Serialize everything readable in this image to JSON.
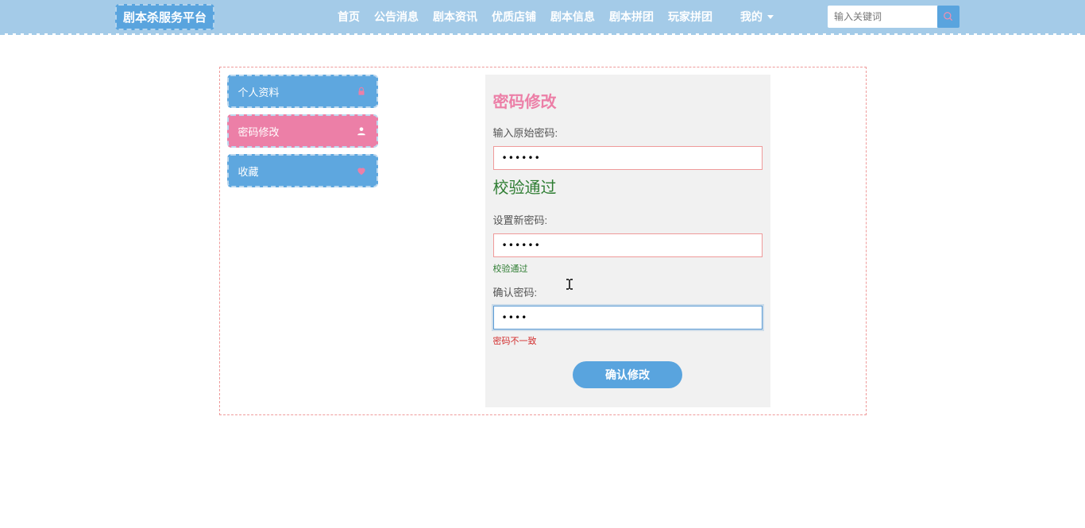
{
  "header": {
    "brand": "剧本杀服务平台",
    "nav": [
      "首页",
      "公告消息",
      "剧本资讯",
      "优质店铺",
      "剧本信息",
      "剧本拼团",
      "玩家拼团"
    ],
    "mine": "我的",
    "search_placeholder": "输入关键词"
  },
  "sidebar": {
    "items": [
      {
        "label": "个人资料",
        "active": false,
        "icon": "lock-icon"
      },
      {
        "label": "密码修改",
        "active": true,
        "icon": "user-icon"
      },
      {
        "label": "收藏",
        "active": false,
        "icon": "heart-icon"
      }
    ]
  },
  "form": {
    "title": "密码修改",
    "original": {
      "label": "输入原始密码:",
      "value": "••••••",
      "status": "校验通过"
    },
    "newpass": {
      "label": "设置新密码:",
      "value": "••••••",
      "status": "校验通过"
    },
    "confirm": {
      "label": "确认密码:",
      "value": "••••",
      "status": "密码不一致"
    },
    "submit": "确认修改"
  }
}
